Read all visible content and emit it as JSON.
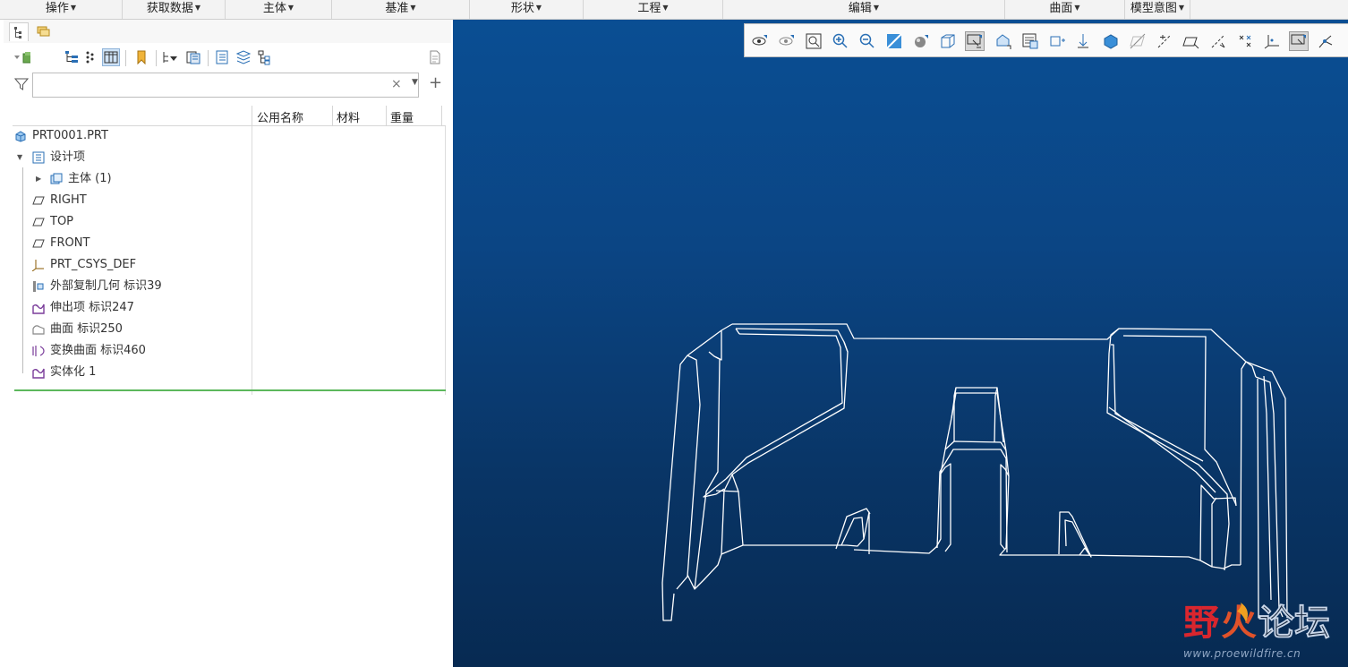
{
  "ribbon": {
    "groups": [
      "操作",
      "获取数据",
      "主体",
      "基准",
      "形状",
      "工程",
      "编辑",
      "曲面",
      "模型意图"
    ]
  },
  "model_tree": {
    "columns": [
      "公用名称",
      "材料",
      "重量"
    ],
    "search": {
      "value": ""
    },
    "items": [
      {
        "label": "PRT0001.PRT",
        "icon": "part-icon"
      },
      {
        "label": "设计项",
        "icon": "design-items-icon"
      },
      {
        "label": "主体 (1)",
        "icon": "body-icon"
      },
      {
        "label": "RIGHT",
        "icon": "datum-plane-icon"
      },
      {
        "label": "TOP",
        "icon": "datum-plane-icon"
      },
      {
        "label": "FRONT",
        "icon": "datum-plane-icon"
      },
      {
        "label": "PRT_CSYS_DEF",
        "icon": "csys-icon"
      },
      {
        "label": "外部复制几何 标识39",
        "icon": "copy-geometry-icon"
      },
      {
        "label": "伸出项 标识247",
        "icon": "protrusion-icon"
      },
      {
        "label": "曲面 标识250",
        "icon": "surface-icon"
      },
      {
        "label": "变换曲面 标识460",
        "icon": "transform-surface-icon"
      },
      {
        "label": "实体化 1",
        "icon": "solidify-icon"
      }
    ]
  },
  "watermark": {
    "main": "野火论坛",
    "sub": "www.proewildfire.cn"
  },
  "colors": {
    "accent_green": "#5cb85c",
    "graphics_top": "#0a4e93",
    "graphics_bottom": "#072a52",
    "wire": "#ffffff",
    "wm_red": "#d9262e"
  }
}
